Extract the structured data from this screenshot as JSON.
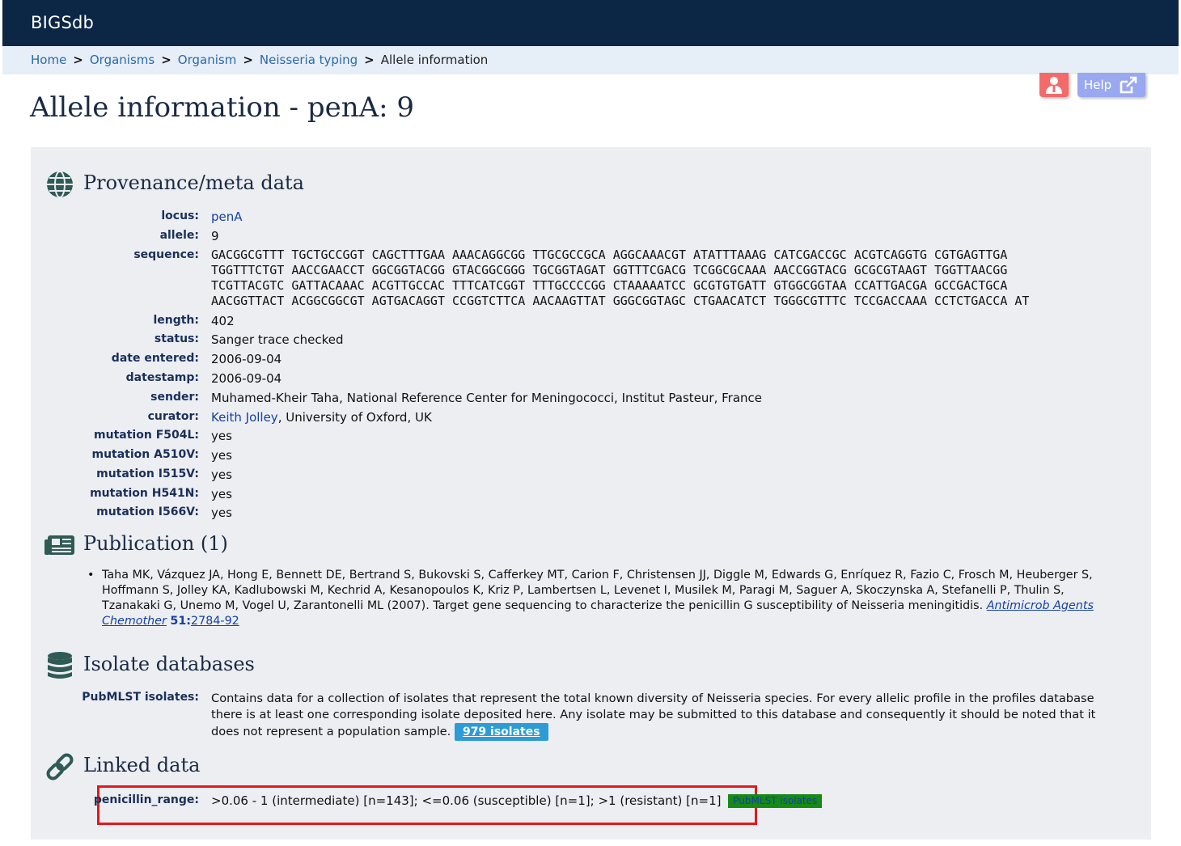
{
  "app": {
    "brand": "BIGSdb"
  },
  "breadcrumb": {
    "items": [
      "Home",
      "Organisms",
      "Organism",
      "Neisseria typing"
    ],
    "current": "Allele information",
    "separator": ">"
  },
  "toolbar": {
    "help_label": "Help"
  },
  "page_title": "Allele information - penA: 9",
  "provenance": {
    "heading": "Provenance/meta data",
    "locus_label": "locus:",
    "locus": "penA",
    "allele_label": "allele:",
    "allele": "9",
    "sequence_label": "sequence:",
    "sequence_lines": [
      "GACGGCGTTT TGCTGCCGGT CAGCTTTGAA AAACAGGCGG TTGCGCCGCA AGGCAAACGT ATATTTAAAG CATCGACCGC ACGTCAGGTG CGTGAGTTGA",
      "TGGTTTCTGT AACCGAACCT GGCGGTACGG GTACGGCGGG TGCGGTAGAT GGTTTCGACG TCGGCGCAAA AACCGGTACG GCGCGTAAGT TGGTTAACGG",
      "TCGTTACGTC GATTACAAAC ACGTTGCCAC TTTCATCGGT TTTGCCCCGG CTAAAAATCC GCGTGTGATT GTGGCGGTAA CCATTGACGA GCCGACTGCA",
      "AACGGTTACT ACGGCGGCGT AGTGACAGGT CCGGTCTTCA AACAAGTTAT GGGCGGTAGC CTGAACATCT TGGGCGTTTC TCCGACCAAA CCTCTGACCA AT"
    ],
    "length_label": "length:",
    "length": "402",
    "status_label": "status:",
    "status": "Sanger trace checked",
    "date_entered_label": "date entered:",
    "date_entered": "2006-09-04",
    "datestamp_label": "datestamp:",
    "datestamp": "2006-09-04",
    "sender_label": "sender:",
    "sender": "Muhamed-Kheir Taha, National Reference Center for Meningococci, Institut Pasteur, France",
    "curator_label": "curator:",
    "curator_name": "Keith Jolley",
    "curator_affil": ", University of Oxford, UK",
    "mutations": [
      {
        "label": "mutation F504L:",
        "value": "yes"
      },
      {
        "label": "mutation A510V:",
        "value": "yes"
      },
      {
        "label": "mutation I515V:",
        "value": "yes"
      },
      {
        "label": "mutation H541N:",
        "value": "yes"
      },
      {
        "label": "mutation I566V:",
        "value": "yes"
      }
    ]
  },
  "publication": {
    "heading": "Publication (1)",
    "text": "Taha MK, Vázquez JA, Hong E, Bennett DE, Bertrand S, Bukovski S, Cafferkey MT, Carion F, Christensen JJ, Diggle M, Edwards G, Enríquez R, Fazio C, Frosch M, Heuberger S, Hoffmann S, Jolley KA, Kadlubowski M, Kechrid A, Kesanopoulos K, Kriz P, Lambertsen L, Levenet I, Musilek M, Paragi M, Saguer A, Skoczynska A, Stefanelli P, Thulin S, Tzanakaki G, Unemo M, Vogel U, Zarantonelli ML (2007). Target gene sequencing to characterize the penicillin G susceptibility of Neisseria meningitidis. ",
    "journal": "Antimicrob Agents Chemother",
    "volume": "51:",
    "pages": "2784-92"
  },
  "isolate_databases": {
    "heading": "Isolate databases",
    "label": "PubMLST isolates:",
    "description": "Contains data for a collection of isolates that represent the total known diversity of Neisseria species. For every allelic profile in the profiles database there is at least one corresponding isolate deposited here. Any isolate may be submitted to this database and consequently it should be noted that it does not represent a population sample.",
    "isolates_badge": "979 isolates"
  },
  "linked_data": {
    "heading": "Linked data",
    "label": "penicillin_range:",
    "value": ">0.06 - 1 (intermediate) [n=143]; <=0.06 (susceptible) [n=1]; >1 (resistant) [n=1]",
    "badge": "PubMLST isolates"
  },
  "icons": {
    "section_provenance": "globe-icon",
    "section_publication": "newspaper-icon",
    "section_isolates": "database-icon",
    "section_linked": "link-icon",
    "user": "user-icon",
    "help_external": "external-link-icon"
  },
  "colors": {
    "topbar": "#0c2645",
    "breadcrumb_bg": "#e6eef8",
    "panel_bg": "#eceef1",
    "link": "#2b6aa6",
    "highlight": "#e8161d",
    "badge_blue": "#2c9bd6",
    "badge_green": "#168a15"
  }
}
